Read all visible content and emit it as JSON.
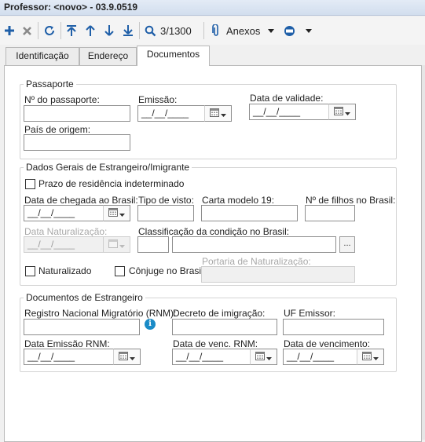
{
  "window": {
    "title": "Professor: <novo> - 03.9.0519"
  },
  "toolbar": {
    "record_position": "3/1300",
    "attachments_label": "Anexos",
    "icons": [
      "add-icon",
      "delete-icon",
      "refresh-icon",
      "first-record-icon",
      "previous-record-icon",
      "next-record-icon",
      "last-record-icon",
      "search-icon",
      "paperclip-icon",
      "chevron-down-icon",
      "status-icon",
      "chevron-down-icon"
    ]
  },
  "tabs": [
    {
      "label": "Identificação",
      "active": false
    },
    {
      "label": "Endereço",
      "active": false
    },
    {
      "label": "Documentos",
      "active": true
    }
  ],
  "passaporte": {
    "title": "Passaporte",
    "numero_label": "Nº do passaporte:",
    "emissao_label": "Emissão:",
    "emissao_value": "__/__/____",
    "validade_label": "Data de validade:",
    "validade_value": "__/__/____",
    "pais_label": "País de origem:"
  },
  "estrangeiro": {
    "title": "Dados Gerais de Estrangeiro/Imigrante",
    "prazo_label": "Prazo de residência indeterminado",
    "chegada_label": "Data de chegada ao Brasil:",
    "chegada_value": "__/__/____",
    "visto_label": "Tipo de visto:",
    "carta_label": "Carta modelo 19:",
    "filhos_label": "Nº de filhos no Brasil:",
    "naturalizacao_label": "Data Naturalização:",
    "naturalizacao_value": "__/__/____",
    "classificacao_label": "Classificação da condição no Brasil:",
    "classificacao_button": "...",
    "naturalizado_label": "Naturalizado",
    "conjuge_label": "Cônjuge no Brasil",
    "portaria_label": "Portaria de Naturalização:"
  },
  "documentos": {
    "title": "Documentos de Estrangeiro",
    "rnm_label": "Registro Nacional Migratório (RNM):",
    "info_glyph": "i",
    "decreto_label": "Decreto de imigração:",
    "uf_label": "UF Emissor:",
    "emissao_rnm_label": "Data Emissão RNM:",
    "emissao_rnm_value": "__/__/____",
    "venc_rnm_label": "Data de venc. RNM:",
    "venc_rnm_value": "__/__/____",
    "vencimento_label": "Data de vencimento:",
    "vencimento_value": "__/__/____"
  },
  "colors": {
    "toolbar_icon": "#1f5fa8",
    "info_icon": "#1a8bc7",
    "titlebar": "#d2deee"
  }
}
